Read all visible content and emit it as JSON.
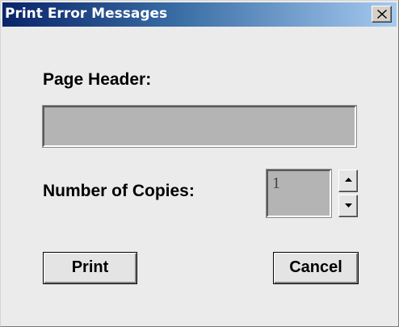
{
  "window": {
    "title": "Print Error Messages",
    "close_icon": "close-x-icon"
  },
  "form": {
    "page_header_label": "Page Header:",
    "page_header_value": "",
    "copies_label": "Number of Copies:",
    "copies_value": "1",
    "spin_up_icon": "arrow-up-icon",
    "spin_down_icon": "arrow-down-icon"
  },
  "buttons": {
    "print_label": "Print",
    "cancel_label": "Cancel"
  },
  "colors": {
    "titlebar_start": "#0a246a",
    "titlebar_end": "#a6caf0",
    "dialog_background": "#ebebeb",
    "field_background": "#b4b4b4"
  }
}
